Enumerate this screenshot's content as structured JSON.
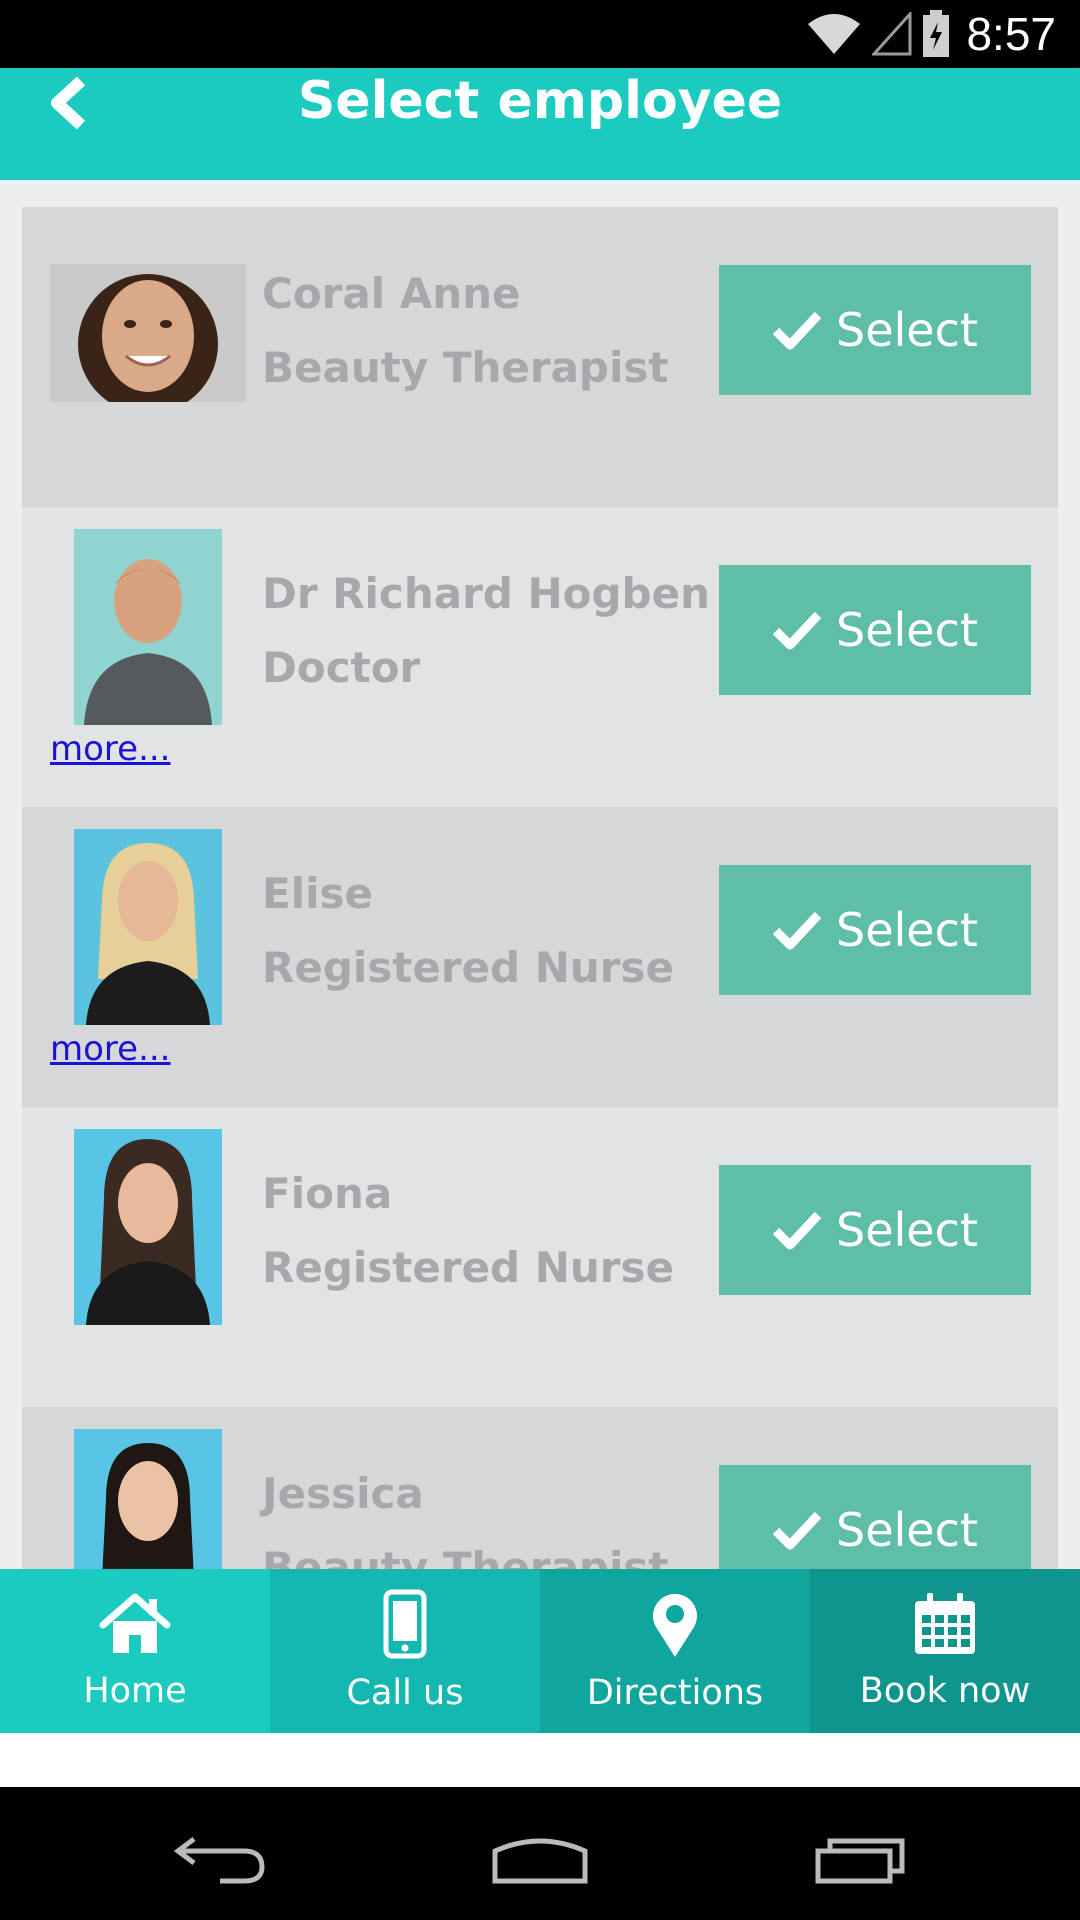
{
  "status_bar": {
    "time": "8:57"
  },
  "header": {
    "title": "Select employee"
  },
  "employees": [
    {
      "name": "Coral Anne",
      "role": "Beauty Therapist",
      "select_label": "Select",
      "more": ""
    },
    {
      "name": "Dr Richard Hogben",
      "role": "Doctor",
      "select_label": "Select",
      "more": "more..."
    },
    {
      "name": "Elise",
      "role": "Registered Nurse",
      "select_label": "Select",
      "more": "more..."
    },
    {
      "name": "Fiona",
      "role": "Registered Nurse",
      "select_label": "Select",
      "more": ""
    },
    {
      "name": "Jessica",
      "role": "Beauty Therapist",
      "select_label": "Select",
      "more": ""
    }
  ],
  "bottom_nav": {
    "items": [
      {
        "label": "Home",
        "icon": "home-icon",
        "color": "#1ccbbf"
      },
      {
        "label": "Call us",
        "icon": "phone-icon",
        "color": "#14b8b0"
      },
      {
        "label": "Directions",
        "icon": "map-pin-icon",
        "color": "#10a69e"
      },
      {
        "label": "Book now",
        "icon": "calendar-icon",
        "color": "#0f958e"
      }
    ]
  },
  "colors": {
    "header": "#1ccbbf",
    "select_button": "#5ebea8",
    "link": "#1a12d9"
  }
}
